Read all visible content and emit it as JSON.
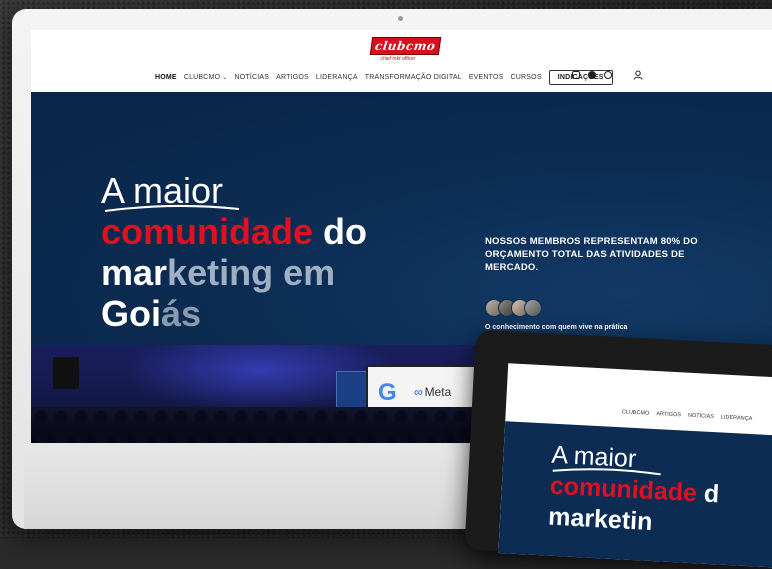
{
  "site": {
    "logo_text": "clubcmo",
    "logo_tagline": "chief mkt officer"
  },
  "nav": {
    "items": [
      "HOME",
      "CLUBCMO",
      "NOTÍCIAS",
      "ARTIGOS",
      "LIDERANÇA",
      "TRANSFORMAÇÃO DIGITAL",
      "EVENTOS",
      "CURSOS"
    ],
    "cta": "INDICAÇÕES",
    "icons": [
      "instagram-icon",
      "spotify-icon",
      "whatsapp-icon",
      "user-icon"
    ]
  },
  "hero": {
    "line1": "A maior",
    "line2_red": "comunidade",
    "line2_white": " do",
    "line3_a": "mar",
    "line3_b": "keting em",
    "line4_a": "Goi",
    "line4_b": "ás",
    "stat": "NOSSOS MEMBROS REPRESENTAM 80% DO ORÇAMENTO TOTAL DAS ATIVIDADES DE MERCADO.",
    "caption": "O conhecimento com quem vive na prática"
  },
  "event": {
    "partner1": "G",
    "partner2": "Meta"
  },
  "tablet": {
    "nav": [
      "CLUBCMO",
      "ARTIGOS",
      "NOTÍCIAS",
      "LIDERANÇA"
    ],
    "line1": "A maior",
    "line2_red": "comunidade",
    "line2_white": " d",
    "line3": "marketin"
  },
  "colors": {
    "accent_red": "#e01020",
    "hero_navy": "#0c2c53"
  }
}
